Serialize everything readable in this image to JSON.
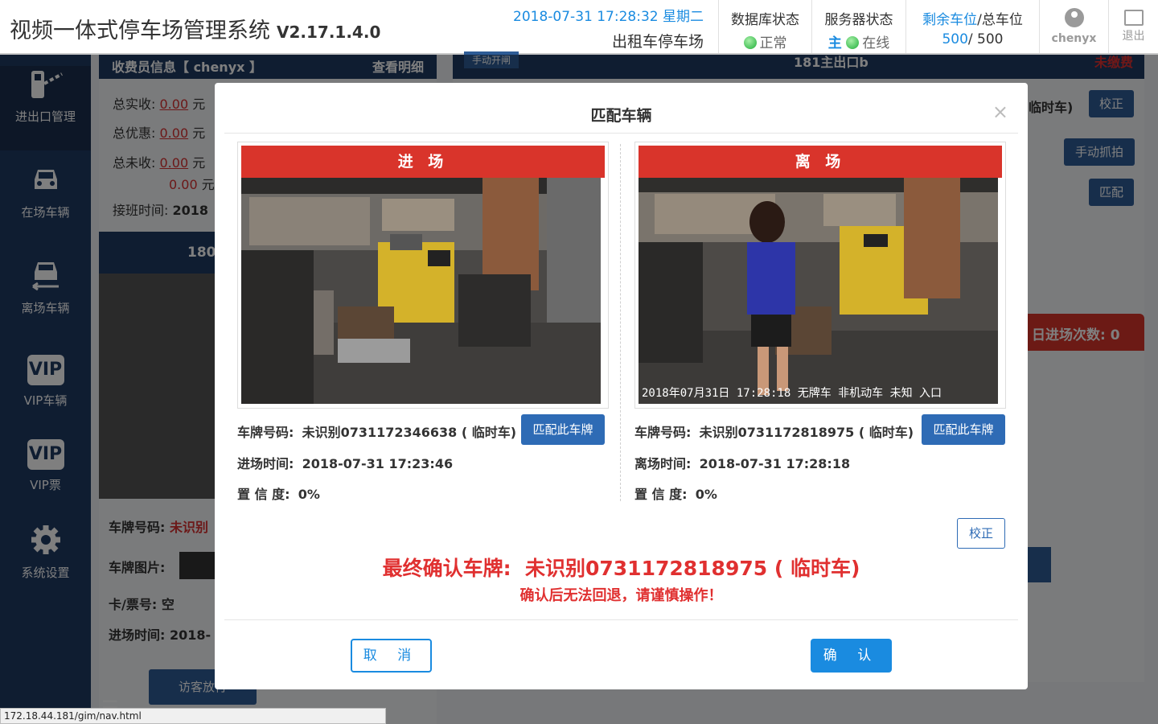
{
  "header": {
    "title": "视频一体式停车场管理系统",
    "version": "V2.17.1.4.0",
    "datetime": "2018-07-31 17:28:32 星期二",
    "lot_name": "出租车停车场",
    "db_status": {
      "label": "数据库状态",
      "value": "正常"
    },
    "server_status": {
      "label": "服务器状态",
      "role": "主",
      "value": "在线"
    },
    "spaces": {
      "label_remaining": "剩余车位",
      "label_total": "/总车位",
      "remaining": "500",
      "total": "/ 500"
    },
    "user": "chenyx",
    "logout": "退出"
  },
  "sidebar": {
    "items": [
      {
        "label": "进出口管理",
        "icon": "gate-barrier-icon"
      },
      {
        "label": "在场车辆",
        "icon": "car-front-icon"
      },
      {
        "label": "离场车辆",
        "icon": "car-leaving-icon"
      },
      {
        "label": "VIP车辆",
        "icon": "vip-icon"
      },
      {
        "label": "VIP票",
        "icon": "vip-ticket-icon"
      },
      {
        "label": "系统设置",
        "icon": "gear-icon"
      }
    ],
    "vip_text": "VIP"
  },
  "background": {
    "cashier_header": "收费员信息【 chenyx 】",
    "view_detail": "查看明细",
    "total_received_label": "总实收:",
    "total_discount_label": "总优惠:",
    "total_unpaid_label": "总未收:",
    "amount": "0.00",
    "unit": "元",
    "shift_time_label": "接班时间:",
    "shift_time": "2018",
    "lane_left": "180",
    "plate_label": "车牌号码:",
    "plate_value": "未识别",
    "plate_image_label": "车牌图片:",
    "card_label": "卡/票号:",
    "card_value": "空",
    "entry_time_label": "进场时间:",
    "entry_time": "2018-",
    "visitor_btn": "访客放行",
    "lane_right": "181主出口b",
    "manual_open": "手动开闸",
    "unpaid": "未缴费",
    "temp_car": "临时车)",
    "calibrate": "校正",
    "manual_capture": "手动抓拍",
    "match": "匹配",
    "today_entries": "日进场次数:",
    "today_entries_value": "0"
  },
  "modal": {
    "title": "匹配车辆",
    "close": "×",
    "entry": {
      "header": "进 场",
      "plate_label": "车牌号码:",
      "plate": "未识别0731172346638 ( 临时车)",
      "match_btn": "匹配此车牌",
      "time_label": "进场时间:",
      "time": "2018-07-31 17:23:46",
      "conf_label": "置 信 度:",
      "conf": "0%"
    },
    "exit": {
      "header": "离 场",
      "plate_label": "车牌号码:",
      "plate": "未识别0731172818975 ( 临时车)",
      "match_btn": "匹配此车牌",
      "time_label": "离场时间:",
      "time": "2018-07-31 17:28:18",
      "conf_label": "置 信 度:",
      "conf": "0%",
      "caption": "2018年07月31日  17:28:18  无牌车 非机动车 未知 入口"
    },
    "calibrate": "校正",
    "final_label": "最终确认车牌:",
    "final_plate": "未识别0731172818975 ( 临时车)",
    "warning": "确认后无法回退，请谨慎操作！",
    "cancel": "取 消",
    "confirm": "确 认"
  },
  "statusbar": "172.18.44.181/gim/nav.html"
}
